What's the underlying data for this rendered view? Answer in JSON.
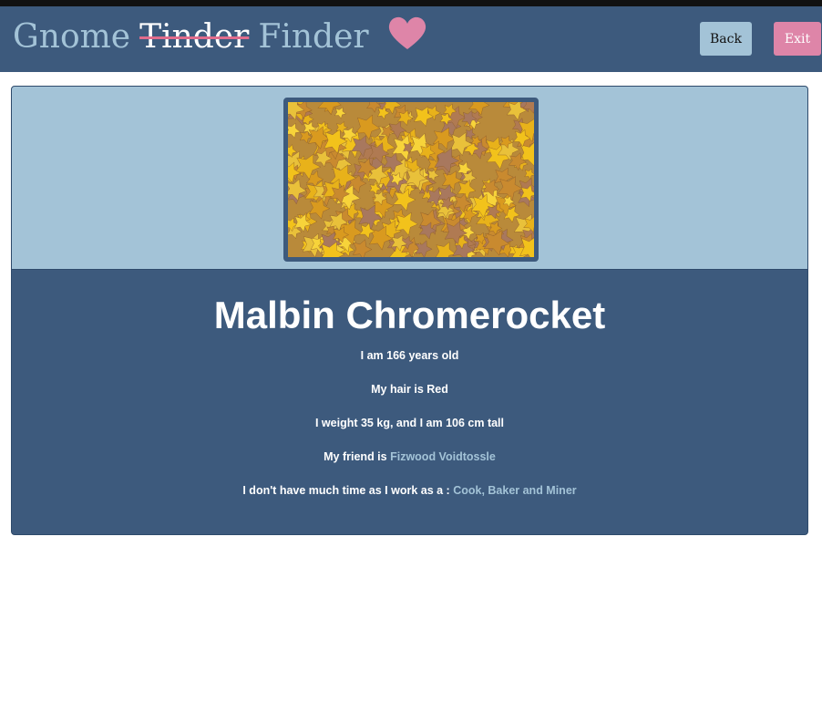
{
  "header": {
    "brand_part1": "Gnome",
    "brand_struck": "Tinder",
    "brand_part2": "Finder",
    "heart_icon": "heart-icon",
    "back_label": "Back",
    "exit_label": "Exit"
  },
  "profile": {
    "photo_icon": "autumn-leaves-photo",
    "name": "Malbin Chromerocket",
    "age_text": "I am 166 years old",
    "hair_text": "My hair is Red",
    "size_text": "I weight 35 kg, and I am 106 cm tall",
    "friend_prefix": "My friend is",
    "friend_name": "Fizwood Voidtossle",
    "work_prefix": "I don't have much time as I work as a :",
    "work_list": "Cook, Baker and Miner"
  },
  "colors": {
    "navbar": "#3d5a7d",
    "light_blue": "#a3c3d7",
    "pink": "#de85a8",
    "strike": "#e06c8c"
  }
}
